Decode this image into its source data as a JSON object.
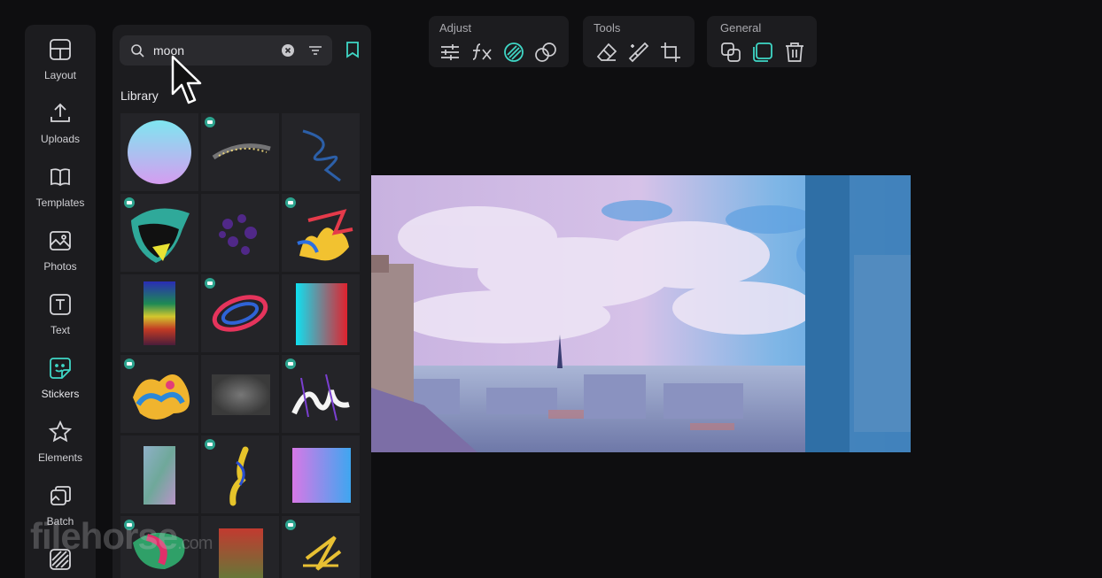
{
  "sidebar": {
    "items": [
      {
        "label": "Layout",
        "icon": "layout-icon"
      },
      {
        "label": "Uploads",
        "icon": "upload-icon"
      },
      {
        "label": "Templates",
        "icon": "templates-icon"
      },
      {
        "label": "Photos",
        "icon": "photos-icon"
      },
      {
        "label": "Text",
        "icon": "text-icon"
      },
      {
        "label": "Stickers",
        "icon": "stickers-icon"
      },
      {
        "label": "Elements",
        "icon": "star-icon"
      },
      {
        "label": "Batch",
        "icon": "batch-icon"
      }
    ]
  },
  "library": {
    "search_value": "moon",
    "title": "Library"
  },
  "toolbar": {
    "adjust_title": "Adjust",
    "tools_title": "Tools",
    "general_title": "General"
  },
  "watermark": {
    "text": "filehorse",
    "suffix": ".com"
  },
  "colors": {
    "accent": "#3fd7c6",
    "panel": "#1c1c1f",
    "background": "#0e0e10",
    "badge": "#2ca38e"
  }
}
